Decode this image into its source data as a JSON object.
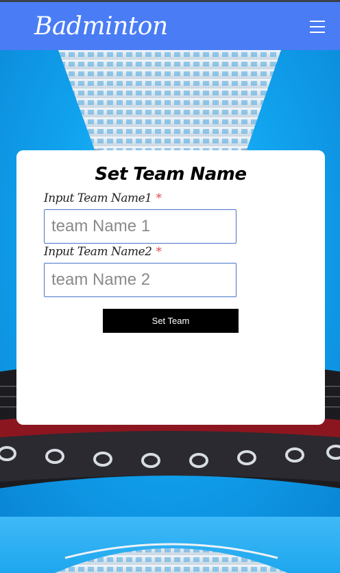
{
  "header": {
    "brand": "Badminton",
    "menu_icon": "hamburger-menu-icon"
  },
  "form": {
    "title": "Set Team Name",
    "team1": {
      "label": "Input Team Name1",
      "required_mark": "*",
      "placeholder": "team Name 1",
      "value": ""
    },
    "team2": {
      "label": "Input Team Name2",
      "required_mark": "*",
      "placeholder": "team Name 2",
      "value": ""
    },
    "submit_label": "Set Team"
  },
  "colors": {
    "header": "#4a7df5",
    "background": "#1aa0e8",
    "button": "#000000",
    "required": "#e0484a",
    "input_border": "#4a74c9"
  }
}
